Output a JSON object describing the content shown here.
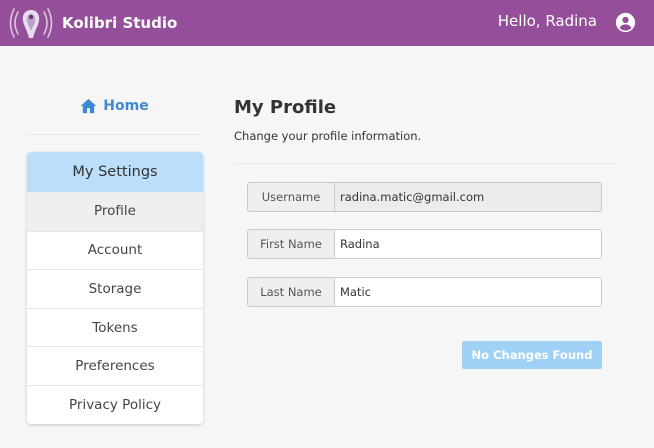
{
  "header": {
    "app_name": "Kolibri Studio",
    "greeting": "Hello, Radina",
    "logo_icon": "kolibri-hummingbird-logo",
    "user_icon": "account-circle-icon",
    "background_color": "#954e9a"
  },
  "sidebar": {
    "home_label": "Home",
    "home_icon": "home-icon",
    "settings_title": "My Settings",
    "items": [
      {
        "label": "Profile",
        "active": true
      },
      {
        "label": "Account",
        "active": false
      },
      {
        "label": "Storage",
        "active": false
      },
      {
        "label": "Tokens",
        "active": false
      },
      {
        "label": "Preferences",
        "active": false
      },
      {
        "label": "Privacy Policy",
        "active": false
      }
    ],
    "accent_color": "#3e8ad2",
    "settings_header_color": "#bbdefa"
  },
  "main": {
    "title": "My Profile",
    "subtitle": "Change your profile information.",
    "fields": {
      "username": {
        "label": "Username",
        "value": "radina.matic@gmail.com",
        "readonly": true
      },
      "first_name": {
        "label": "First Name",
        "value": "Radina",
        "readonly": false
      },
      "last_name": {
        "label": "Last Name",
        "value": "Matic",
        "readonly": false
      }
    },
    "save_button": {
      "label": "No Changes Found",
      "disabled": true,
      "color": "#9fd0f6"
    }
  }
}
